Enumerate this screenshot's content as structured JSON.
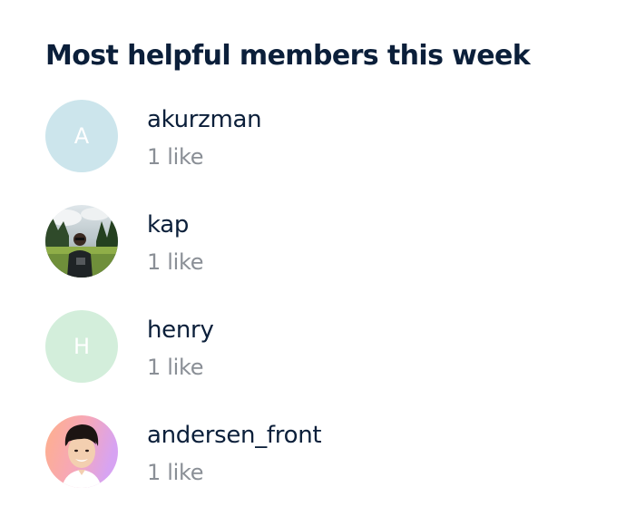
{
  "widget": {
    "title": "Most helpful members this week"
  },
  "members": [
    {
      "name": "akurzman",
      "likes": "1 like",
      "avatar_letter": "A",
      "avatar_type": "letter",
      "avatar_color": "#cce5ec"
    },
    {
      "name": "kap",
      "likes": "1 like",
      "avatar_type": "photo",
      "avatar_icon": "outdoor-portrait-photo"
    },
    {
      "name": "henry",
      "likes": "1 like",
      "avatar_letter": "H",
      "avatar_type": "letter",
      "avatar_color": "#d3eedb"
    },
    {
      "name": "andersen_front",
      "likes": "1 like",
      "avatar_type": "photo",
      "avatar_icon": "portrait-photo-gradient"
    }
  ],
  "colors": {
    "text_primary": "#0b1f3a",
    "text_secondary": "#8a8f96"
  }
}
